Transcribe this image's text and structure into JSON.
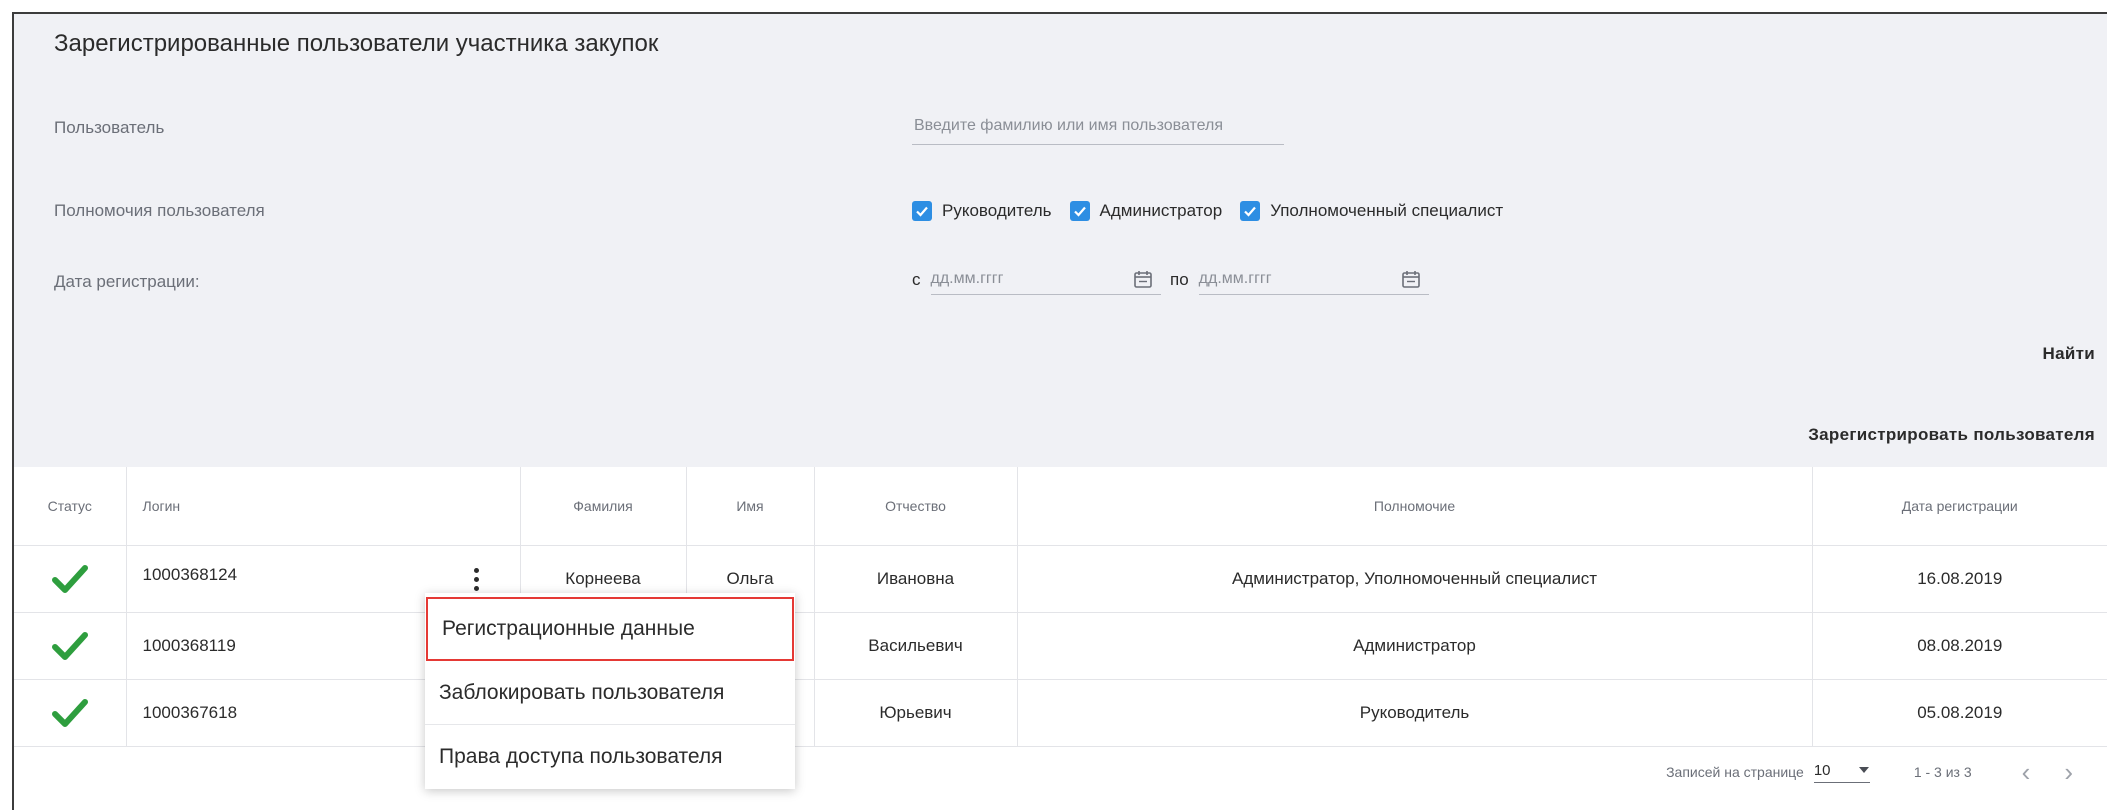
{
  "panel": {
    "title": "Зарегистрированные пользователи участника закупок",
    "user_label": "Пользователь",
    "user_placeholder": "Введите фамилию или имя пользователя",
    "rights_label": "Полномочия пользователя",
    "rights": [
      {
        "label": "Руководитель",
        "checked": true
      },
      {
        "label": "Администратор",
        "checked": true
      },
      {
        "label": "Уполномоченный специалист",
        "checked": true
      }
    ],
    "date_label": "Дата регистрации:",
    "date_from_prefix": "с",
    "date_from_placeholder": "дд.мм.гггг",
    "date_to_prefix": "по",
    "date_to_placeholder": "дд.мм.гггг",
    "find_button": "Найти",
    "register_button": "Зарегистрировать пользователя"
  },
  "table": {
    "headers": [
      "Статус",
      "Логин",
      "Фамилия",
      "Имя",
      "Отчество",
      "Полномочие",
      "Дата регистрации"
    ],
    "rows": [
      {
        "status_icon": "check-icon",
        "login": "1000368124",
        "last_name": "Корнеева",
        "first_name": "Ольга",
        "patronymic": "Ивановна",
        "rights": "Администратор, Уполномоченный специалист",
        "date": "16.08.2019"
      },
      {
        "status_icon": "check-icon",
        "login": "1000368119",
        "last_name": "",
        "first_name": "",
        "patronymic": "Васильевич",
        "rights": "Администратор",
        "date": "08.08.2019"
      },
      {
        "status_icon": "check-icon",
        "login": "1000367618",
        "last_name": "",
        "first_name": "",
        "patronymic": "Юрьевич",
        "rights": "Руководитель",
        "date": "05.08.2019"
      }
    ]
  },
  "context_menu": {
    "items": [
      "Регистрационные данные",
      "Заблокировать пользователя",
      "Права доступа пользователя"
    ]
  },
  "pagination": {
    "per_page_label": "Записей на странице",
    "per_page_value": "10",
    "range": "1 - 3 из 3"
  },
  "colors": {
    "panel_bg": "#f0f1f5",
    "checkbox": "#2d8ee3",
    "status_ok": "#2e9e3e",
    "menu_highlight": "#e53935"
  }
}
